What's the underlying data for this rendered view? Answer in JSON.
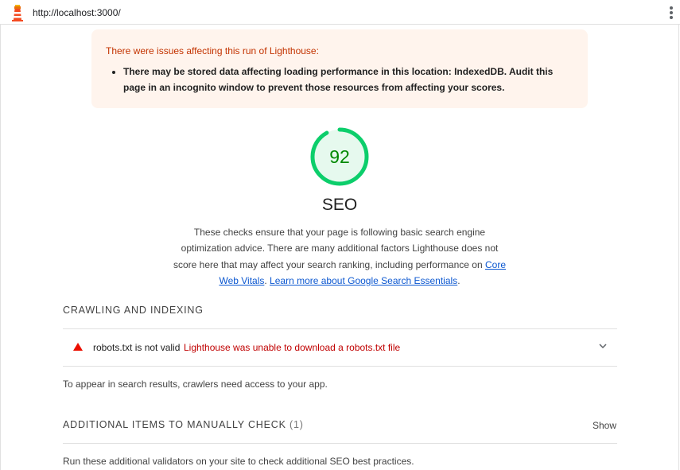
{
  "browser": {
    "url": "http://localhost:3000/",
    "logo_icon": "lighthouse-icon",
    "menu_icon": "kebab-menu-icon"
  },
  "warning": {
    "title": "There were issues affecting this run of Lighthouse:",
    "items": [
      "There may be stored data affecting loading performance in this location: IndexedDB. Audit this page in an incognito window to prevent those resources from affecting your scores."
    ],
    "background_color": "#fff4ed",
    "title_color": "#c33300"
  },
  "category": {
    "score": 92,
    "score_text": "92",
    "title": "SEO",
    "gauge_color": "#0cce6b",
    "score_color": "#008800",
    "description_text": "These checks ensure that your page is following basic search engine optimization advice. There are many additional factors Lighthouse does not score here that may affect your search ranking, including performance on ",
    "link_core_web_vitals": "Core Web Vitals",
    "separator": ". ",
    "link_learn_more": "Learn more about Google Search Essentials",
    "end_period": "."
  },
  "groups": {
    "crawling": {
      "title": "CRAWLING AND INDEXING",
      "audit": {
        "status_icon": "fail-triangle-icon",
        "title": "robots.txt is not valid",
        "detail": "Lighthouse was unable to download a robots.txt file",
        "expand_icon": "chevron-down-icon"
      },
      "description": "To appear in search results, crawlers need access to your app."
    },
    "additional": {
      "title": "ADDITIONAL ITEMS TO MANUALLY CHECK",
      "count": "(1)",
      "show_label": "Show",
      "description": "Run these additional validators on your site to check additional SEO best practices."
    }
  },
  "colors": {
    "fail": "#eb0f00",
    "link": "#0b57d0",
    "divider": "#e0e0e0"
  }
}
